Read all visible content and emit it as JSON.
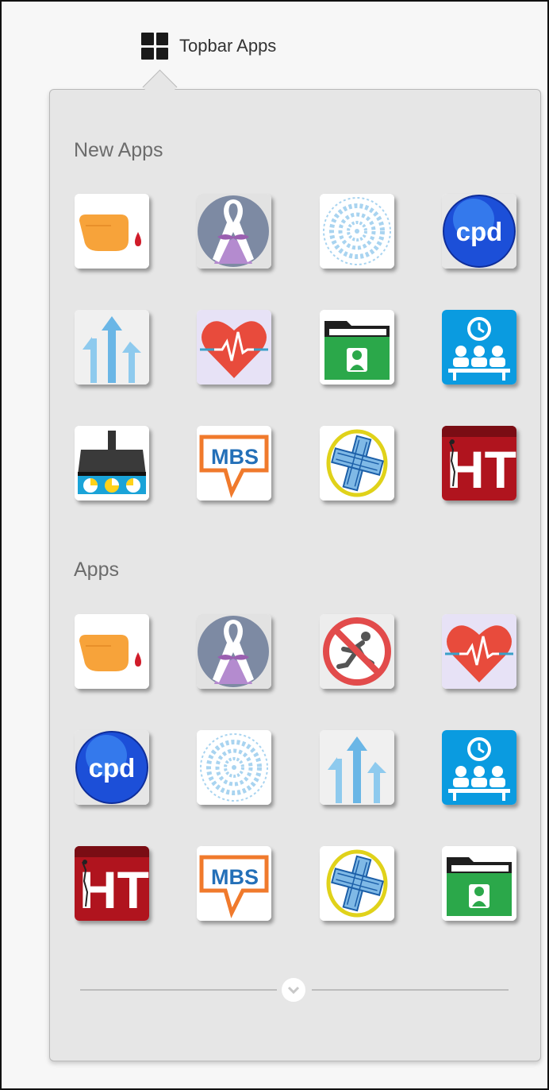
{
  "topbar": {
    "label": "Topbar Apps",
    "icon": "grid-icon"
  },
  "sections": [
    {
      "title": "New Apps",
      "apps": [
        "finger-blood-icon",
        "ribbon-mustache-icon",
        "dot-circle-icon",
        "cpd-icon",
        "arrows-up-icon",
        "heart-pulse-icon",
        "patient-folder-icon",
        "waiting-room-icon",
        "machine-chart-icon",
        "mbs-icon",
        "medical-cross-icon",
        "ht-icon"
      ]
    },
    {
      "title": "Apps",
      "apps": [
        "finger-blood-icon",
        "ribbon-mustache-icon",
        "no-falling-icon",
        "heart-pulse-icon",
        "cpd-icon",
        "dot-circle-icon",
        "arrows-up-icon",
        "waiting-room-icon",
        "ht-icon",
        "mbs-icon",
        "medical-cross-icon",
        "patient-folder-icon"
      ]
    }
  ],
  "icon_text": {
    "cpd": "cpd",
    "mbs": "MBS",
    "ht": "HT"
  },
  "expand_icon": "chevron-down-icon",
  "colors": {
    "panel": "#e6e6e6",
    "accent_blue": "#0a9be0",
    "heart": "#e84b3c"
  }
}
